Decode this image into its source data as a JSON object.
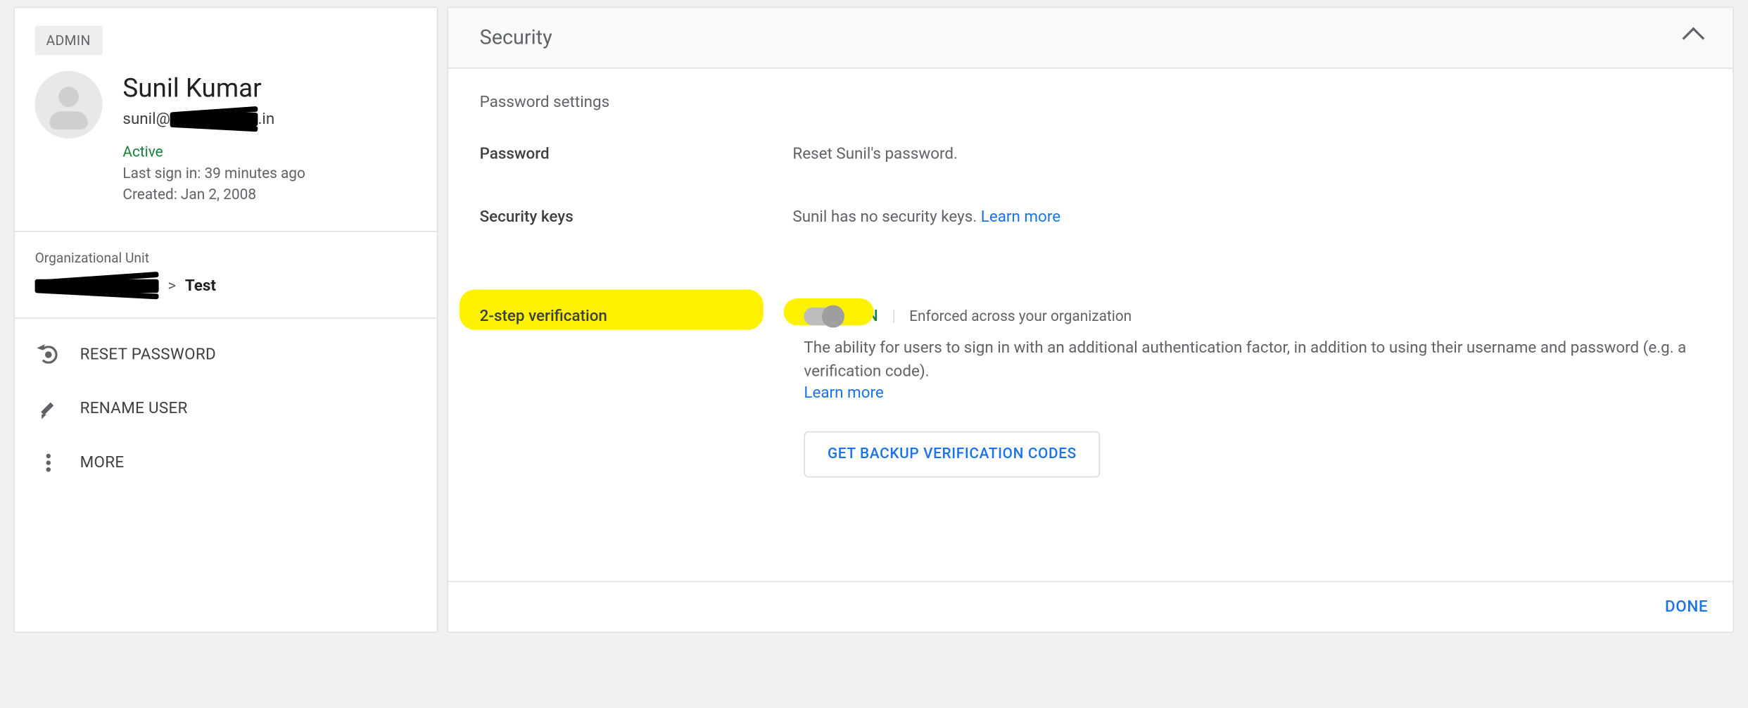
{
  "profile": {
    "admin_chip": "ADMIN",
    "name": "Sunil Kumar",
    "email_prefix": "sunil@",
    "email_suffix": ".in",
    "status": "Active",
    "last_signin": "Last sign in: 39 minutes ago",
    "created": "Created: Jan 2, 2008"
  },
  "org_unit": {
    "label": "Organizational Unit",
    "separator": ">",
    "leaf": "Test"
  },
  "actions": {
    "reset_password": "RESET PASSWORD",
    "rename_user": "RENAME USER",
    "more": "MORE"
  },
  "panel": {
    "title": "Security",
    "password_settings_heading": "Password settings",
    "password_label": "Password",
    "password_value": "Reset Sunil's password.",
    "security_keys_label": "Security keys",
    "security_keys_value": "Sunil has no security keys. ",
    "security_keys_link": "Learn more",
    "tsv_label": "2-step verification",
    "tsv_state": "ON",
    "tsv_enforced": "Enforced across your organization",
    "tsv_desc": "The ability for users to sign in with an additional authentication factor, in addition to using their username and password (e.g. a verification code).",
    "tsv_learn_more": "Learn more",
    "backup_button": "GET BACKUP VERIFICATION CODES",
    "done": "DONE"
  }
}
